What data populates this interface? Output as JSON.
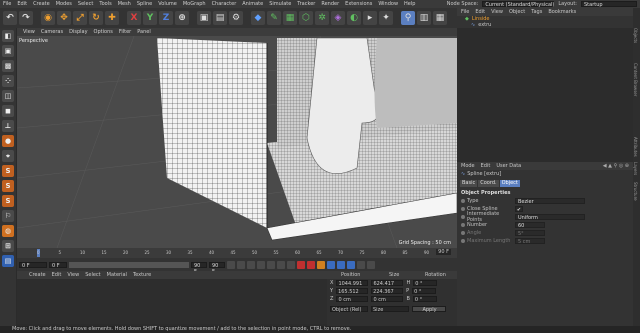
{
  "menu": [
    "File",
    "Edit",
    "Create",
    "Modes",
    "Select",
    "Tools",
    "Mesh",
    "Spline",
    "Volume",
    "MoGraph",
    "Character",
    "Animate",
    "Simulate",
    "Tracker",
    "Render",
    "Extensions",
    "Window",
    "Help"
  ],
  "node_space_label": "Node Space:",
  "node_space_value": "Current (Standard/Physical)",
  "layout_label": "Layout:",
  "layout_value": "Startup",
  "toolbar_letters": {
    "x": "X",
    "y": "Y",
    "z": "Z"
  },
  "viewport": {
    "menu": [
      "View",
      "Cameras",
      "Display",
      "Options",
      "Filter",
      "Panel"
    ],
    "label": "Perspective",
    "grid_spacing": "Grid Spacing : 50 cm"
  },
  "objects": {
    "tabs": [
      "File",
      "Edit",
      "View",
      "Object",
      "Tags",
      "Bookmarks"
    ],
    "items": [
      "Linside",
      "extru"
    ]
  },
  "attributes": {
    "menu": [
      "Mode",
      "Edit",
      "User Data"
    ],
    "object_title": "Spline [extru]",
    "tabs": [
      "Basic",
      "Coord.",
      "Object"
    ],
    "section": "Object Properties",
    "props": [
      {
        "label": "Type",
        "value": "Bezier"
      },
      {
        "label": "Close Spline",
        "value": "✔"
      },
      {
        "label": "Intermediate Points",
        "value": "Uniform"
      },
      {
        "label": "Number",
        "value": "60"
      },
      {
        "label": "Angle",
        "value": "5°"
      },
      {
        "label": "Maximum Length",
        "value": "5 cm"
      }
    ]
  },
  "timeline": {
    "ticks": [
      "0",
      "5",
      "10",
      "15",
      "20",
      "25",
      "30",
      "35",
      "40",
      "45",
      "50",
      "55",
      "60",
      "65",
      "70",
      "75",
      "80",
      "85",
      "90"
    ],
    "start_frame": "0 F",
    "min": "0 F",
    "max": "90 F",
    "end": "90 F",
    "current": "0 F"
  },
  "materials_menu": [
    "Create",
    "Edit",
    "View",
    "Select",
    "Material",
    "Texture"
  ],
  "coords": {
    "headers": [
      "Position",
      "Size",
      "Rotation"
    ],
    "rows": [
      {
        "a": "X",
        "p": "1044.991 cm",
        "s": "624.417 cm",
        "rl": "H",
        "r": "0 °"
      },
      {
        "a": "Y",
        "p": "165.512 cm",
        "s": "224.367 cm",
        "rl": "P",
        "r": "0 °"
      },
      {
        "a": "Z",
        "p": "0 cm",
        "s": "0 cm",
        "rl": "B",
        "r": "0 °"
      }
    ],
    "mode": "Object (Rel)",
    "size_mode": "Size",
    "apply": "Apply"
  },
  "status": "Move: Click and drag to move elements. Hold down SHIFT to quantize movement / add to the selection in point mode, CTRL to remove.",
  "right_strip": [
    "Objects",
    "Content Browser",
    "Attributes",
    "Layers",
    "Structure"
  ]
}
